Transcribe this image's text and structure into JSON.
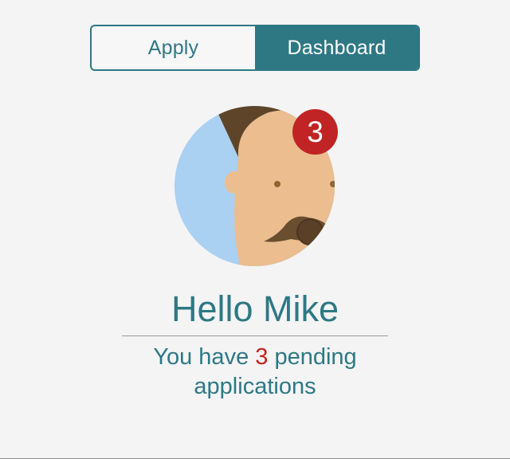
{
  "tabs": [
    {
      "label": "Apply",
      "active": false
    },
    {
      "label": "Dashboard",
      "active": true
    }
  ],
  "profile": {
    "avatar_icon": "user-avatar-mustache",
    "notification_count": "3"
  },
  "greeting": "Hello Mike",
  "pending": {
    "prefix": "You have",
    "count": "3",
    "suffix": "pending applications"
  },
  "colors": {
    "accent": "#2e7884",
    "badge": "#c12424",
    "background": "#f4f4f4"
  }
}
